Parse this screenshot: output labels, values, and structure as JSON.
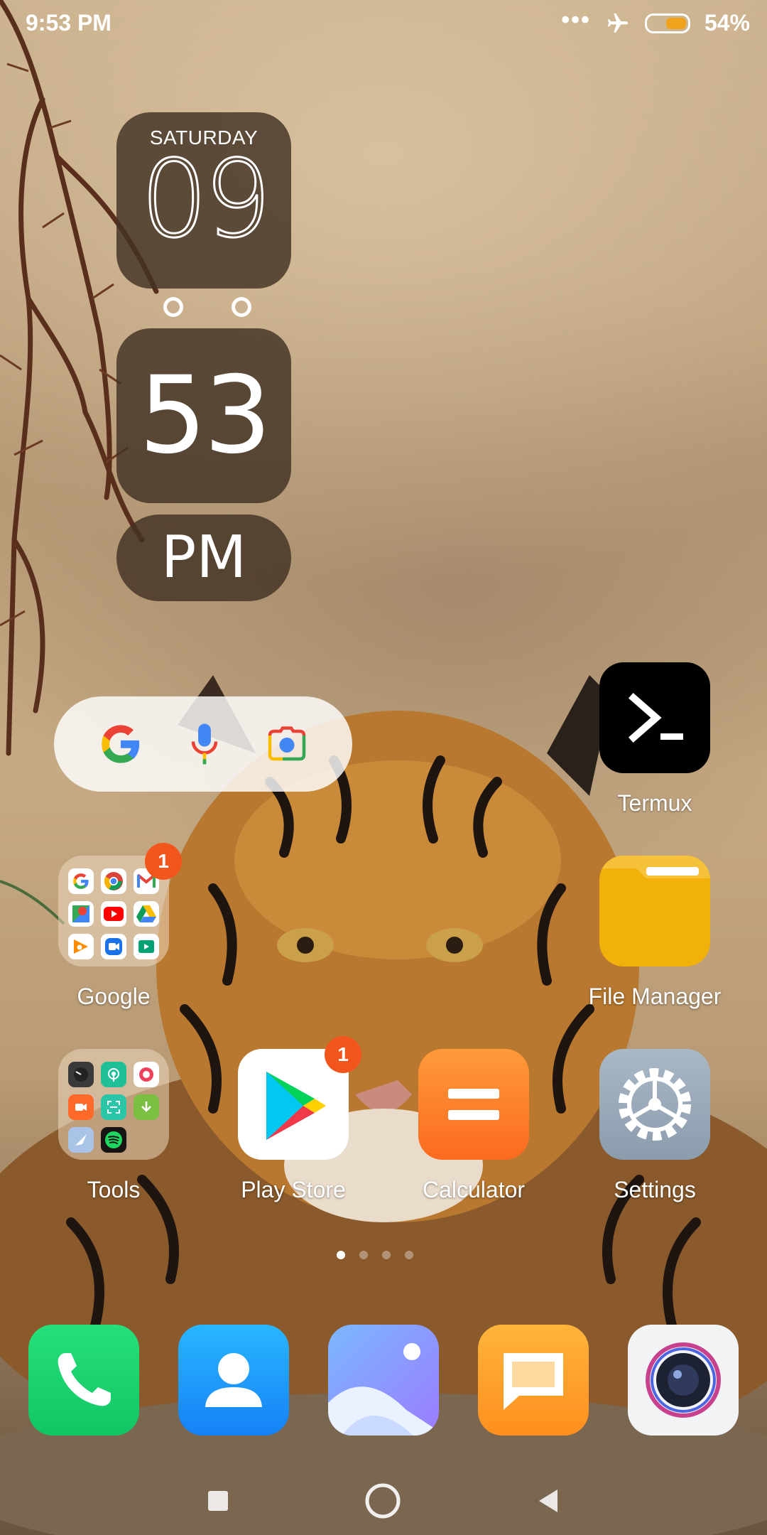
{
  "status_bar": {
    "time": "9:53 PM",
    "more": "•••",
    "battery_percent": "54%",
    "battery_level": 0.54,
    "icons": [
      "airplane-mode-icon",
      "battery-icon"
    ]
  },
  "clock_widget": {
    "day": "SATURDAY",
    "hour": "09",
    "minute": "53",
    "ampm": "PM"
  },
  "search_widget": {
    "icons": [
      "google-g-icon",
      "microphone-icon",
      "google-lens-icon"
    ]
  },
  "home_apps": [
    {
      "label": "Termux"
    },
    {
      "label": "Google",
      "badge": "1"
    },
    {
      "label": "File Manager"
    },
    {
      "label": "Tools"
    },
    {
      "label": "Play Store",
      "badge": "1"
    },
    {
      "label": "Calculator"
    },
    {
      "label": "Settings"
    }
  ],
  "pager": {
    "pages": 4,
    "current": 1
  },
  "dock": {
    "apps": [
      "phone-icon",
      "contacts-icon",
      "gallery-icon",
      "messages-icon",
      "camera-icon"
    ]
  },
  "nav_bar": {
    "buttons": [
      "recents-button",
      "home-button",
      "back-button"
    ]
  },
  "colors": {
    "badge": "#f2561d",
    "battery_fill": "#f0a21c",
    "clock_bg": "#423224"
  }
}
